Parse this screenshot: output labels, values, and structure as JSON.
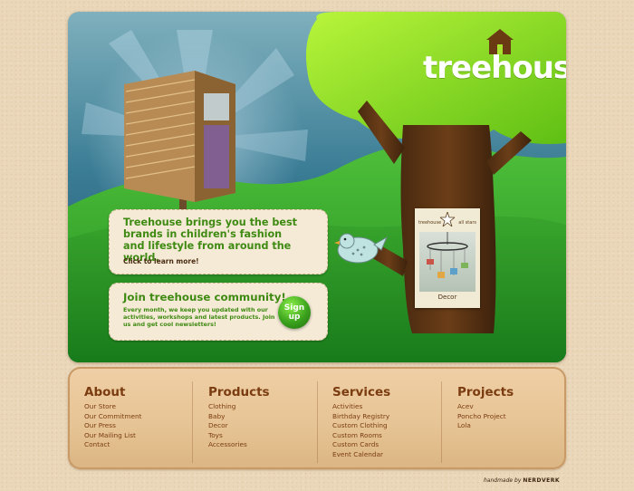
{
  "brand": {
    "logo_text": "treehouse",
    "house_icon": "house-icon"
  },
  "promo": {
    "headline": "Treehouse brings you the best brands in children's fashion and lifestyle from around the world.",
    "cta": "Click to learn more!"
  },
  "community": {
    "title": "Join treehouse community!",
    "body": "Every month, we keep you updated with our activities, workshops and latest products. Join us and get cool newsletters!",
    "signup_label": "Sign\nup"
  },
  "decor_card": {
    "left_tag": "treehouse",
    "right_tag": "all stars",
    "label": "Decor"
  },
  "footer": {
    "columns": [
      {
        "title": "About",
        "links": [
          "Our Store",
          "Our Commitment",
          "Our Press",
          "Our Mailing List",
          "Contact"
        ]
      },
      {
        "title": "Products",
        "links": [
          "Clothing",
          "Baby",
          "Decor",
          "Toys",
          "Accessories"
        ]
      },
      {
        "title": "Services",
        "links": [
          "Activities",
          "Birthday Registry",
          "Custom Clothing",
          "Custom Rooms",
          "Custom Cards",
          "Event Calendar"
        ]
      },
      {
        "title": "Projects",
        "links": [
          "Acev",
          "Poncho Project",
          "Lola"
        ]
      }
    ]
  },
  "credit": {
    "prefix": "handmade by",
    "name": "NERDVERK"
  },
  "colors": {
    "accent_green": "#3f8a12",
    "brown": "#7a3c10",
    "grass": "#1f8f1f"
  }
}
